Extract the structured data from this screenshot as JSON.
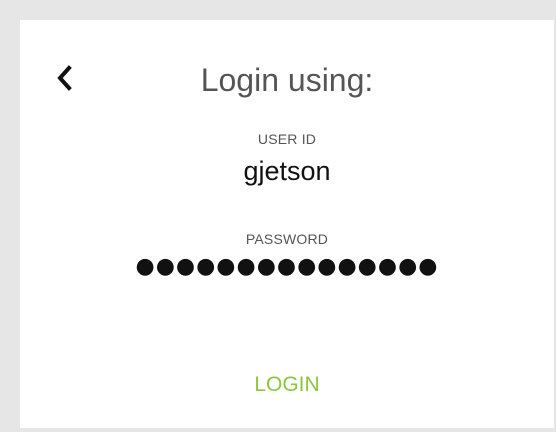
{
  "header": {
    "title": "Login using:",
    "back_icon": "chevron-left-icon"
  },
  "user_id": {
    "label": "USER ID",
    "value": "gjetson"
  },
  "password": {
    "label": "PASSWORD",
    "value": "●●●●●●●●●●●●●●●"
  },
  "actions": {
    "login_label": "LOGIN"
  },
  "colors": {
    "accent": "#8cc63f",
    "background": "#e6e6e6",
    "card": "#ffffff",
    "text": "#111111",
    "muted_text": "#555555"
  }
}
